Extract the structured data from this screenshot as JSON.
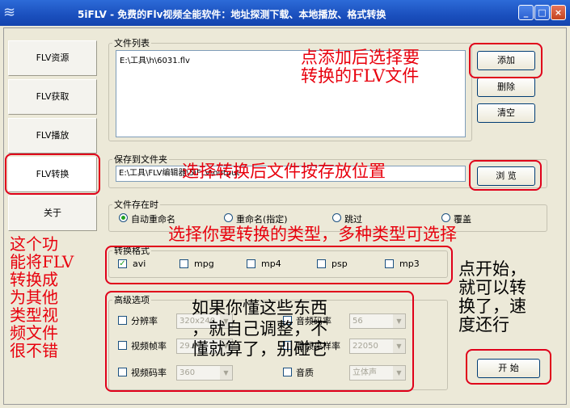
{
  "window": {
    "title": "5iFLV - 免费的Flv视频全能软件：地址探测下载、本地播放、格式转换"
  },
  "nav": [
    {
      "label": "FLV资源"
    },
    {
      "label": "FLV获取"
    },
    {
      "label": "FLV播放"
    },
    {
      "label": "FLV转换"
    },
    {
      "label": "关于"
    }
  ],
  "file_list": {
    "legend": "文件列表",
    "items": [
      "E:\\工具\\h\\6031.flv"
    ]
  },
  "buttons": {
    "add": "添加",
    "delete": "删除",
    "clear": "清空",
    "browse": "浏 览",
    "start": "开 始"
  },
  "save_folder": {
    "legend": "保存到文件夹",
    "path": "E:\\工具\\FLV编辑器\\5iFLV\\output"
  },
  "file_exists": {
    "legend": "文件存在时",
    "options": [
      "自动重命名",
      "重命名(指定)",
      "跳过",
      "覆盖"
    ],
    "selected": 0
  },
  "format": {
    "legend": "转换格式",
    "options": [
      {
        "label": "avi",
        "checked": true
      },
      {
        "label": "mpg",
        "checked": false
      },
      {
        "label": "mp4",
        "checked": false
      },
      {
        "label": "psp",
        "checked": false
      },
      {
        "label": "mp3",
        "checked": false
      }
    ]
  },
  "advanced": {
    "legend": "高级选项",
    "resolution": {
      "label": "分辨率",
      "value": "320x240"
    },
    "frame_rate": {
      "label": "视频帧率",
      "value": "29.97"
    },
    "video_bitrate": {
      "label": "视频码率",
      "value": "360"
    },
    "audio_bitrate": {
      "label": "音频码率",
      "value": "56"
    },
    "audio_samplerate": {
      "label": "音频采样率",
      "value": "22050"
    },
    "audio_quality": {
      "label": "音质",
      "value": "立体声"
    }
  },
  "annotations": {
    "add_hint_1": "点添加后选择要",
    "add_hint_2": "转换的FLV文件",
    "save_hint": "选择转换后文件按存放位置",
    "format_hint": "选择你要转换的类型，多种类型可选择",
    "left_hint": [
      "这个功",
      "能将FLV",
      "转换成",
      "为其他",
      "类型视",
      "频文件",
      "很不错"
    ],
    "advanced_hint": [
      "如果你懂这些东西",
      "，就自己调整，不",
      "懂就算了，别碰它"
    ],
    "start_hint": [
      "点开始，",
      "就可以转",
      "换了，速",
      "度还行"
    ]
  }
}
